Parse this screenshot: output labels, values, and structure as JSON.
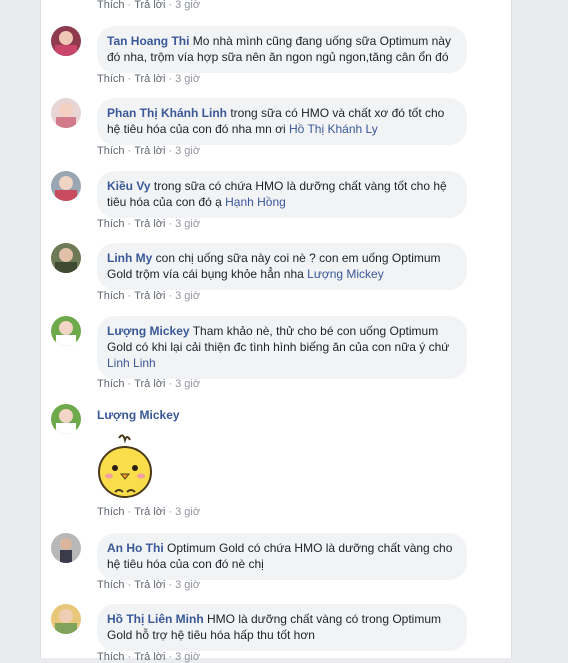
{
  "actions": {
    "like": "Thích",
    "reply": "Trả lời",
    "sep": "·"
  },
  "top_actions": {
    "time": "3 giờ"
  },
  "comments": [
    {
      "author": "Tan Hoang Thi",
      "text": "Mo nhà mình cũng đang uống sữa Optimum này đó nha, trộm vía hợp sữa nên ăn ngon ngủ ngon,tăng cân ổn đó",
      "mention": "",
      "time": "3 giờ"
    },
    {
      "author": "Phan Thị Khánh Linh",
      "text": "trong sữa có HMO và chất xơ đó tốt cho hệ tiêu hóa của con đó nha mn ơi",
      "mention": "Hồ Thị Khánh Ly",
      "time": "3 giờ"
    },
    {
      "author": "Kiều Vy",
      "text": "trong sữa có chứa HMO là dưỡng chất vàng tốt cho hệ tiêu hóa của con đó ạ",
      "mention": "Hạnh Hồng",
      "time": "3 giờ"
    },
    {
      "author": "Linh My",
      "text": "con chị uống sữa này coi nè ? con em uống Optimum Gold trộm vía cái bụng khỏe hẳn nha",
      "mention": "Lượng Mickey",
      "time": "3 giờ"
    },
    {
      "author": "Lượng Mickey",
      "text": "Tham khảo nè, thử cho bé con uống Optimum Gold có khi lại cải thiện đc tình hình biếng ăn của con nữa ý chứ",
      "mention": "Linh Linh",
      "time": "3 giờ"
    },
    {
      "author": "Lượng Mickey",
      "text": "",
      "mention": "",
      "time": "3 giờ"
    },
    {
      "author": "An Ho Thi",
      "text": "Optimum Gold có chứa HMO là dưỡng chất vàng cho hệ tiêu hóa của con đó nè chị",
      "mention": "",
      "time": "3 giờ"
    },
    {
      "author": "Hồ Thị Liên Minh",
      "text": "HMO là dưỡng chất vàng có trong Optimum Gold hỗ trợ hệ tiêu hóa hấp thu tốt hơn",
      "mention": "",
      "time": "3 giờ"
    }
  ],
  "colors": {
    "author": "#385898",
    "bubble": "#f2f3f5",
    "meta": "#90949c",
    "page_bg": "#e9ebee"
  }
}
